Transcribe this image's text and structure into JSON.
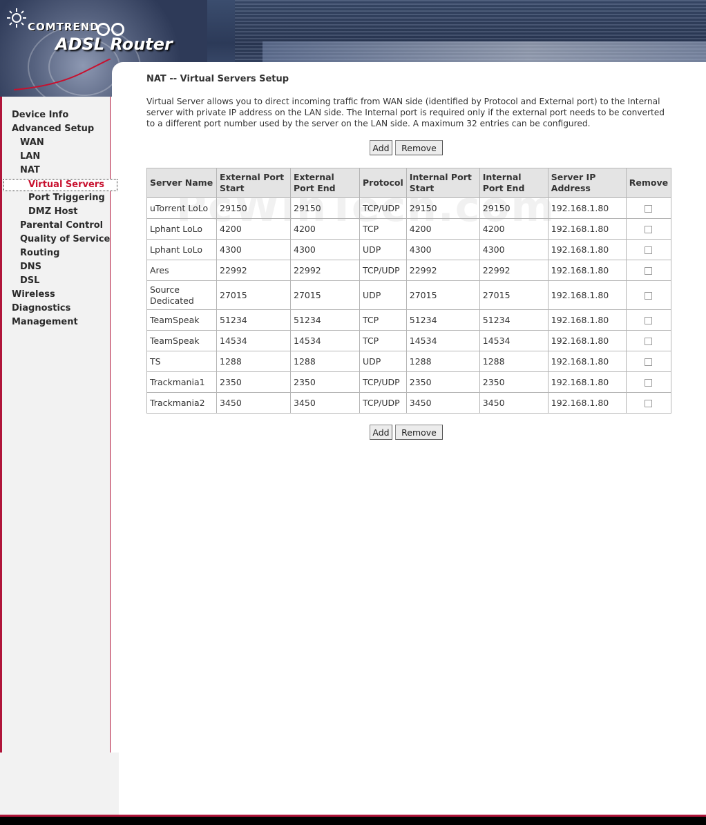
{
  "brand": {
    "company": "COMTREND",
    "product": "ADSL Router"
  },
  "sidebar": {
    "items": [
      {
        "label": "Device Info",
        "level": 0
      },
      {
        "label": "Advanced Setup",
        "level": 0
      },
      {
        "label": "WAN",
        "level": 1
      },
      {
        "label": "LAN",
        "level": 1
      },
      {
        "label": "NAT",
        "level": 1
      },
      {
        "label": "Virtual Servers",
        "level": 2,
        "active": true
      },
      {
        "label": "Port Triggering",
        "level": 2
      },
      {
        "label": "DMZ Host",
        "level": 2
      },
      {
        "label": "Parental Control",
        "level": 1
      },
      {
        "label": "Quality of Service",
        "level": 1
      },
      {
        "label": "Routing",
        "level": 1
      },
      {
        "label": "DNS",
        "level": 1
      },
      {
        "label": "DSL",
        "level": 1
      },
      {
        "label": "Wireless",
        "level": 0
      },
      {
        "label": "Diagnostics",
        "level": 0
      },
      {
        "label": "Management",
        "level": 0
      }
    ]
  },
  "main": {
    "title": "NAT -- Virtual Servers Setup",
    "description": "Virtual Server allows you to direct incoming traffic from WAN side (identified by Protocol and External port) to the Internal server with private IP address on the LAN side. The Internal port is required only if the external port needs to be converted to a different port number used by the server on the LAN side. A maximum 32 entries can be configured.",
    "add_label": "Add",
    "remove_label": "Remove",
    "watermark": "PcWinTech.com"
  },
  "table": {
    "headers": [
      "Server Name",
      "External Port Start",
      "External Port End",
      "Protocol",
      "Internal Port Start",
      "Internal Port End",
      "Server IP Address",
      "Remove"
    ],
    "rows": [
      [
        "uTorrent LoLo",
        "29150",
        "29150",
        "TCP/UDP",
        "29150",
        "29150",
        "192.168.1.80"
      ],
      [
        "Lphant LoLo",
        "4200",
        "4200",
        "TCP",
        "4200",
        "4200",
        "192.168.1.80"
      ],
      [
        "Lphant LoLo",
        "4300",
        "4300",
        "UDP",
        "4300",
        "4300",
        "192.168.1.80"
      ],
      [
        "Ares",
        "22992",
        "22992",
        "TCP/UDP",
        "22992",
        "22992",
        "192.168.1.80"
      ],
      [
        "Source Dedicated",
        "27015",
        "27015",
        "UDP",
        "27015",
        "27015",
        "192.168.1.80"
      ],
      [
        "TeamSpeak",
        "51234",
        "51234",
        "TCP",
        "51234",
        "51234",
        "192.168.1.80"
      ],
      [
        "TeamSpeak",
        "14534",
        "14534",
        "TCP",
        "14534",
        "14534",
        "192.168.1.80"
      ],
      [
        "TS",
        "1288",
        "1288",
        "UDP",
        "1288",
        "1288",
        "192.168.1.80"
      ],
      [
        "Trackmania1",
        "2350",
        "2350",
        "TCP/UDP",
        "2350",
        "2350",
        "192.168.1.80"
      ],
      [
        "Trackmania2",
        "3450",
        "3450",
        "TCP/UDP",
        "3450",
        "3450",
        "192.168.1.80"
      ]
    ]
  },
  "colors": {
    "accent": "#c8102e",
    "sidebar_border": "#b0153a",
    "header_bg": "#2c3a58"
  }
}
